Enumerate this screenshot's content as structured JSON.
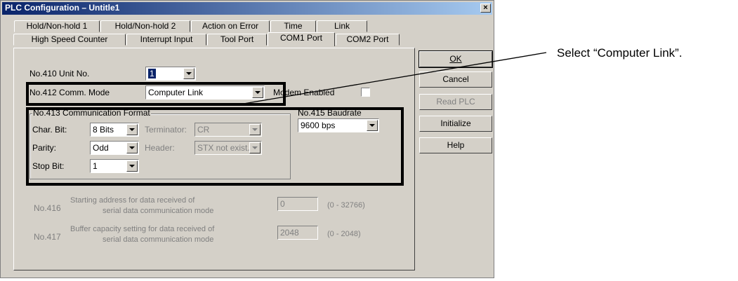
{
  "window": {
    "title": "PLC Configuration – Untitle1",
    "close_symbol": "×"
  },
  "tabs_row1": [
    "Hold/Non-hold 1",
    "Hold/Non-hold 2",
    "Action on Error",
    "Time",
    "Link"
  ],
  "tabs_row2": [
    "High Speed Counter",
    "Interrupt Input",
    "Tool Port",
    "COM1 Port",
    "COM2 Port"
  ],
  "active_tab": "COM1 Port",
  "unit": {
    "label": "No.410   Unit No.",
    "value": "1"
  },
  "comm_mode": {
    "label": "No.412   Comm. Mode",
    "value": "Computer Link",
    "modem_label": "Modem Enabled",
    "modem_checked": false
  },
  "format": {
    "group_label": "No.413 Communication Format",
    "char_bit": {
      "label": "Char. Bit:",
      "value": "8 Bits"
    },
    "parity": {
      "label": "Parity:",
      "value": "Odd"
    },
    "stop_bit": {
      "label": "Stop Bit:",
      "value": "1"
    },
    "terminator": {
      "label": "Terminator:",
      "value": "CR"
    },
    "header": {
      "label": "Header:",
      "value": "STX not exist."
    }
  },
  "baudrate": {
    "label": "No.415   Baudrate",
    "value": "9600 bps"
  },
  "no416": {
    "num": "No.416",
    "line1": "Starting address for data received of",
    "line2": "serial data communication mode",
    "value": "0",
    "range": "(0 - 32766)"
  },
  "no417": {
    "num": "No.417",
    "line1": "Buffer capacity setting for data received of",
    "line2": "serial data communication mode",
    "value": "2048",
    "range": "(0 - 2048)"
  },
  "buttons": {
    "ok": "OK",
    "cancel": "Cancel",
    "read_plc": "Read PLC",
    "initialize": "Initialize",
    "help": "Help"
  },
  "annotation": "Select “Computer Link”."
}
